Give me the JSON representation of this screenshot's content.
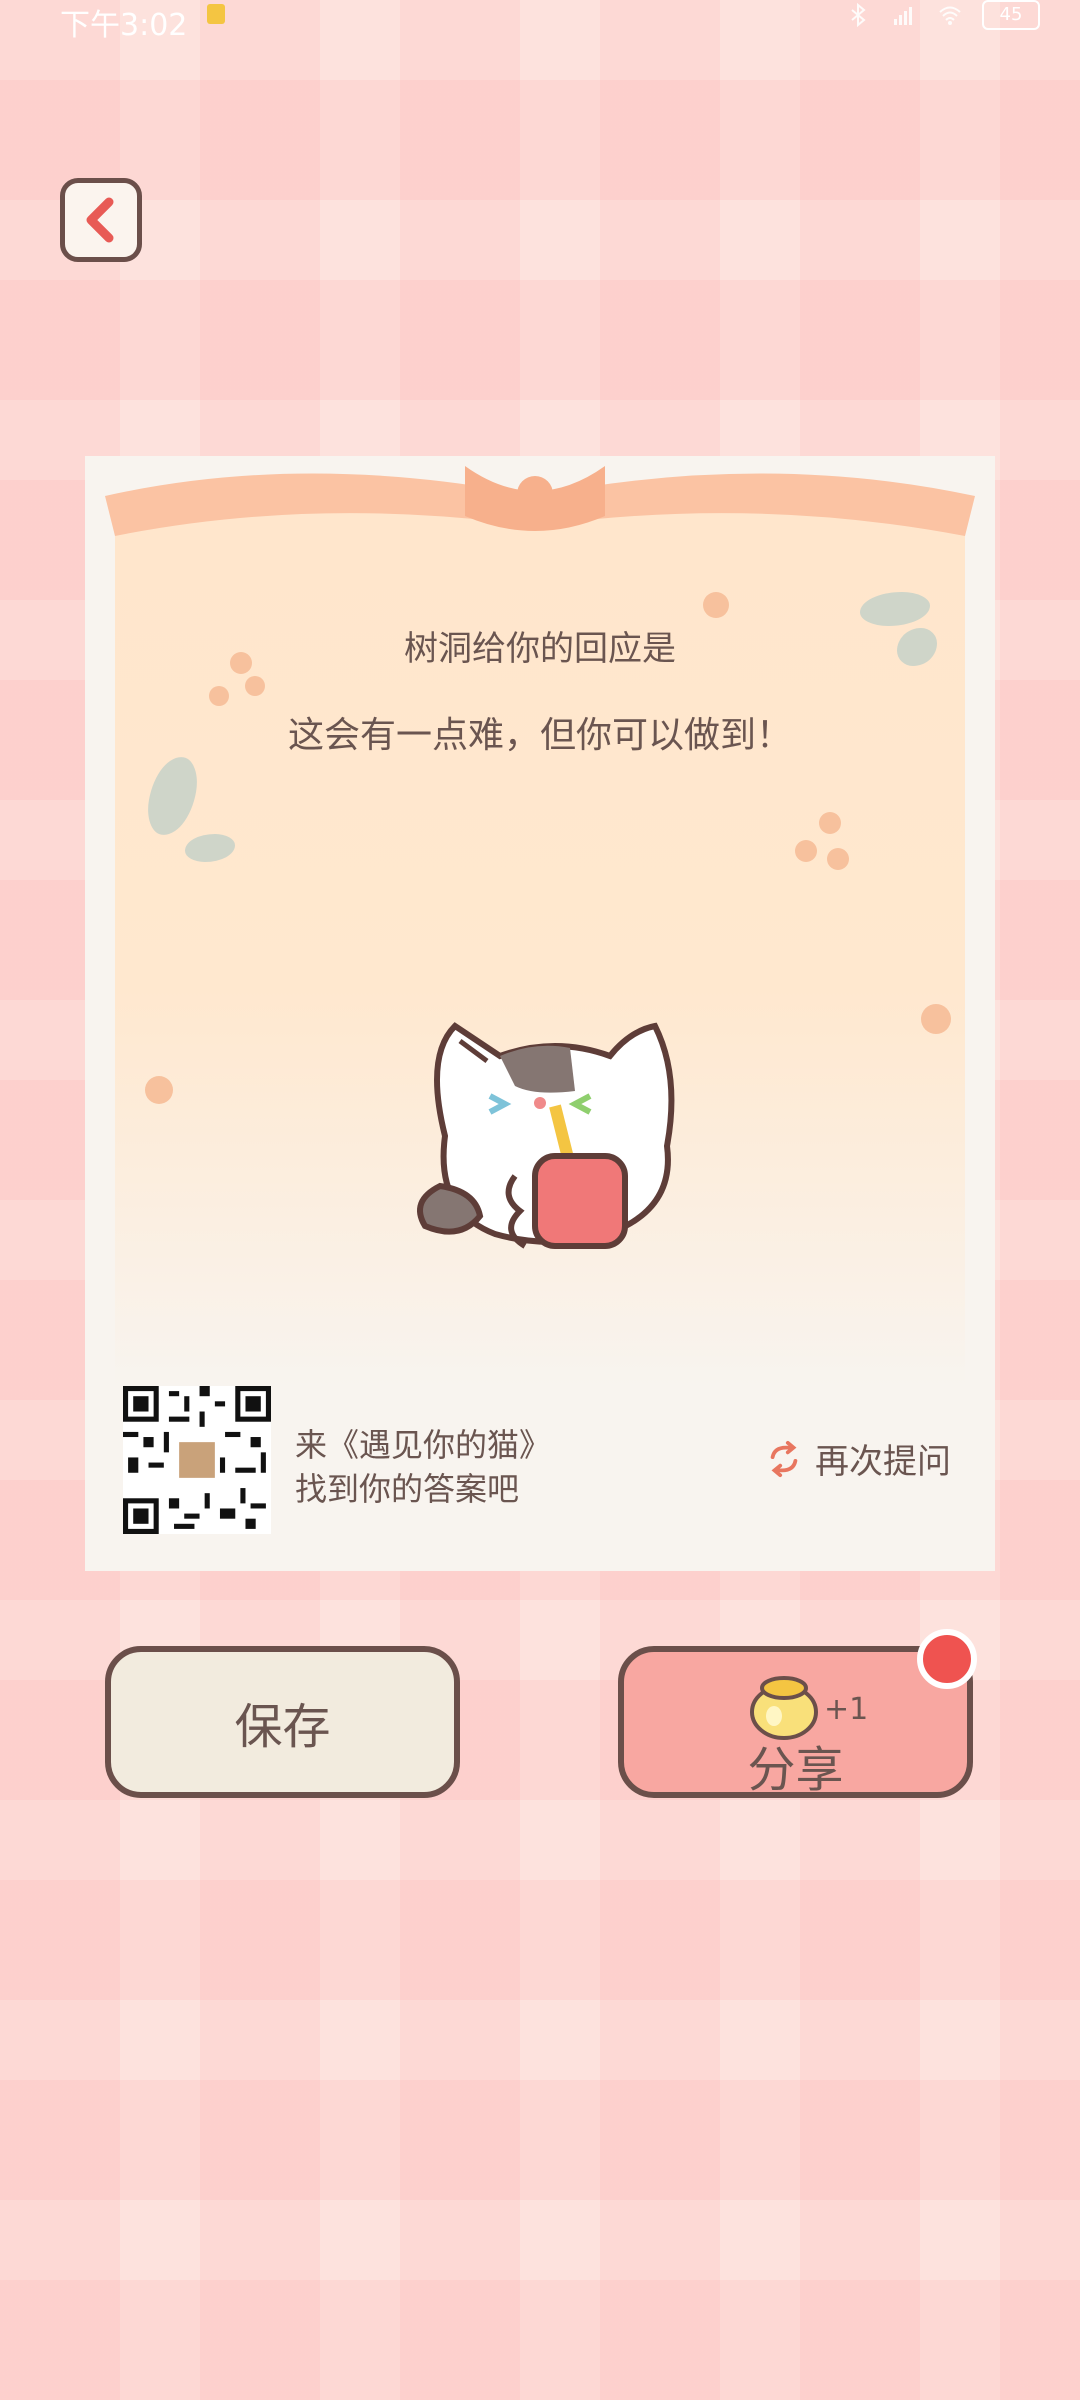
{
  "status_bar": {
    "time": "下午3:02",
    "battery": "45"
  },
  "card": {
    "title": "树洞给你的回应是",
    "response": "这会有一点难，但你可以做到！",
    "invite_line1": "来《遇见你的猫》",
    "invite_line2": "找到你的答案吧",
    "ask_again_label": "再次提问"
  },
  "actions": {
    "save_label": "保存",
    "share_label": "分享",
    "share_reward": "+1"
  },
  "colors": {
    "background": "#fde2dd",
    "border": "#6b4f4a",
    "share_button": "#f8a7a1",
    "save_button": "#f2ebde",
    "notification_dot": "#ef5350"
  },
  "icons": {
    "back": "back-chevron-icon",
    "refresh": "refresh-icon",
    "coin": "coin-pot-icon"
  }
}
